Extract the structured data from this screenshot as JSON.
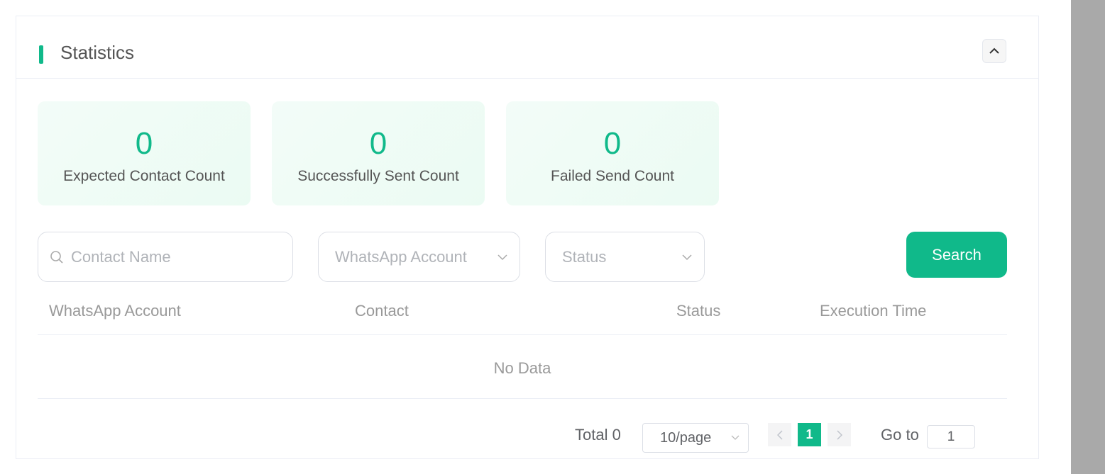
{
  "header": {
    "title": "Statistics"
  },
  "stats": [
    {
      "value": "0",
      "label": "Expected Contact Count"
    },
    {
      "value": "0",
      "label": "Successfully Sent Count"
    },
    {
      "value": "0",
      "label": "Failed Send Count"
    }
  ],
  "filters": {
    "contact_placeholder": "Contact Name",
    "account_placeholder": "WhatsApp Account",
    "status_placeholder": "Status",
    "search_label": "Search"
  },
  "table": {
    "columns": [
      "WhatsApp Account",
      "Contact",
      "Status",
      "Execution Time"
    ],
    "empty_text": "No Data"
  },
  "pagination": {
    "total": "Total 0",
    "page_size": "10/page",
    "current_page": "1",
    "goto_label": "Go to",
    "goto_value": "1"
  },
  "colors": {
    "accent": "#10b98a"
  }
}
